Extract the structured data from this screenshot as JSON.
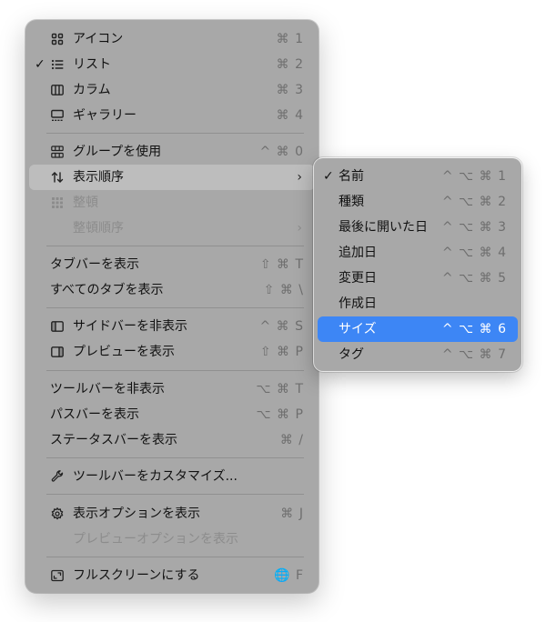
{
  "menu": {
    "items": [
      {
        "label": "アイコン",
        "shortcut": "⌘ 1",
        "icon": "grid-icon",
        "checked": false
      },
      {
        "label": "リスト",
        "shortcut": "⌘ 2",
        "icon": "list-icon",
        "checked": true
      },
      {
        "label": "カラム",
        "shortcut": "⌘ 3",
        "icon": "columns-icon",
        "checked": false
      },
      {
        "label": "ギャラリー",
        "shortcut": "⌘ 4",
        "icon": "gallery-icon",
        "checked": false
      },
      {
        "label": "グループを使用",
        "shortcut": "^ ⌘ 0",
        "icon": "group-icon"
      },
      {
        "label": "表示順序",
        "icon": "sort-arrows-icon"
      },
      {
        "label": "整頓",
        "icon": "cleanup-grid-icon"
      },
      {
        "label": "整頓順序"
      },
      {
        "label": "タブバーを表示",
        "shortcut": "⇧ ⌘ T"
      },
      {
        "label": "すべてのタブを表示",
        "shortcut": "⇧ ⌘ \\"
      },
      {
        "label": "サイドバーを非表示",
        "shortcut": "^ ⌘ S",
        "icon": "sidebar-icon"
      },
      {
        "label": "プレビューを表示",
        "shortcut": "⇧ ⌘ P",
        "icon": "preview-pane-icon"
      },
      {
        "label": "ツールバーを非表示",
        "shortcut": "⌥ ⌘ T"
      },
      {
        "label": "パスバーを表示",
        "shortcut": "⌥ ⌘ P"
      },
      {
        "label": "ステータスバーを表示",
        "shortcut": "⌘ /"
      },
      {
        "label": "ツールバーをカスタマイズ...",
        "icon": "wrench-icon"
      },
      {
        "label": "表示オプションを表示",
        "shortcut": "⌘ J",
        "icon": "gear-icon"
      },
      {
        "label": "プレビューオプションを表示"
      },
      {
        "label": "フルスクリーンにする",
        "shortcut": "🌐 F",
        "icon": "fullscreen-icon"
      }
    ],
    "check_mark": "✓",
    "submenu_arrow": "›"
  },
  "submenu": {
    "items": [
      {
        "label": "名前",
        "shortcut": "^ ⌥ ⌘ 1",
        "checked": true
      },
      {
        "label": "種類",
        "shortcut": "^ ⌥ ⌘ 2"
      },
      {
        "label": "最後に開いた日",
        "shortcut": "^ ⌥ ⌘ 3"
      },
      {
        "label": "追加日",
        "shortcut": "^ ⌥ ⌘ 4"
      },
      {
        "label": "変更日",
        "shortcut": "^ ⌥ ⌘ 5"
      },
      {
        "label": "作成日"
      },
      {
        "label": "サイズ",
        "shortcut": "^ ⌥ ⌘ 6",
        "highlighted": true
      },
      {
        "label": "タグ",
        "shortcut": "^ ⌥ ⌘ 7"
      }
    ]
  },
  "colors": {
    "highlight": "#3d86f5",
    "menu_bg": "#a8a8a8",
    "hover": "#bdbdbd"
  }
}
